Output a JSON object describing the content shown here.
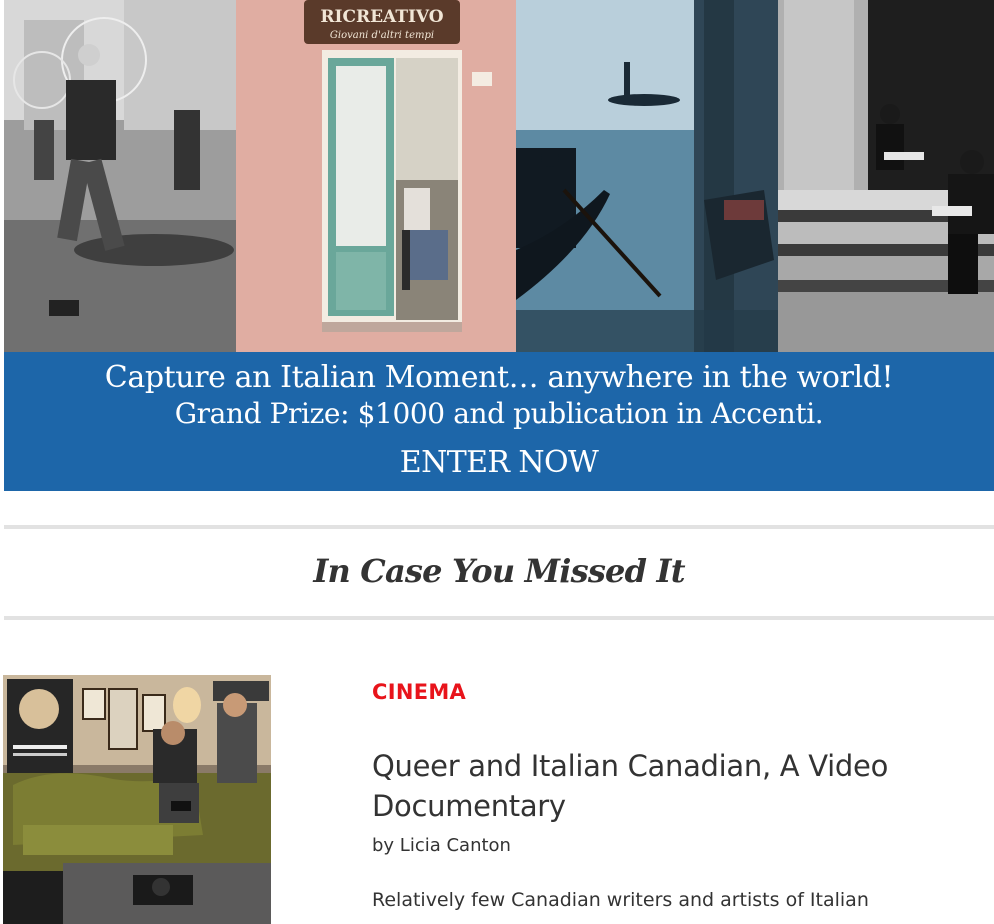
{
  "banner": {
    "sign_text": "RICREATIVO",
    "sign_subtext": "Giovani d'altri tempi",
    "line1": "Capture an Italian Moment…  anywhere in the world!",
    "line2": "Grand Prize: $1000 and publication in Accenti.",
    "cta": "ENTER NOW",
    "background_color": "#1d66a9"
  },
  "section": {
    "title": "In Case You Missed It"
  },
  "article": {
    "category": "CINEMA",
    "category_color": "#e8141b",
    "title": "Queer and Italian Canadian, A Video Documentary",
    "byline": "by Licia Canton",
    "excerpt": "Relatively few Canadian writers and artists of Italian"
  }
}
